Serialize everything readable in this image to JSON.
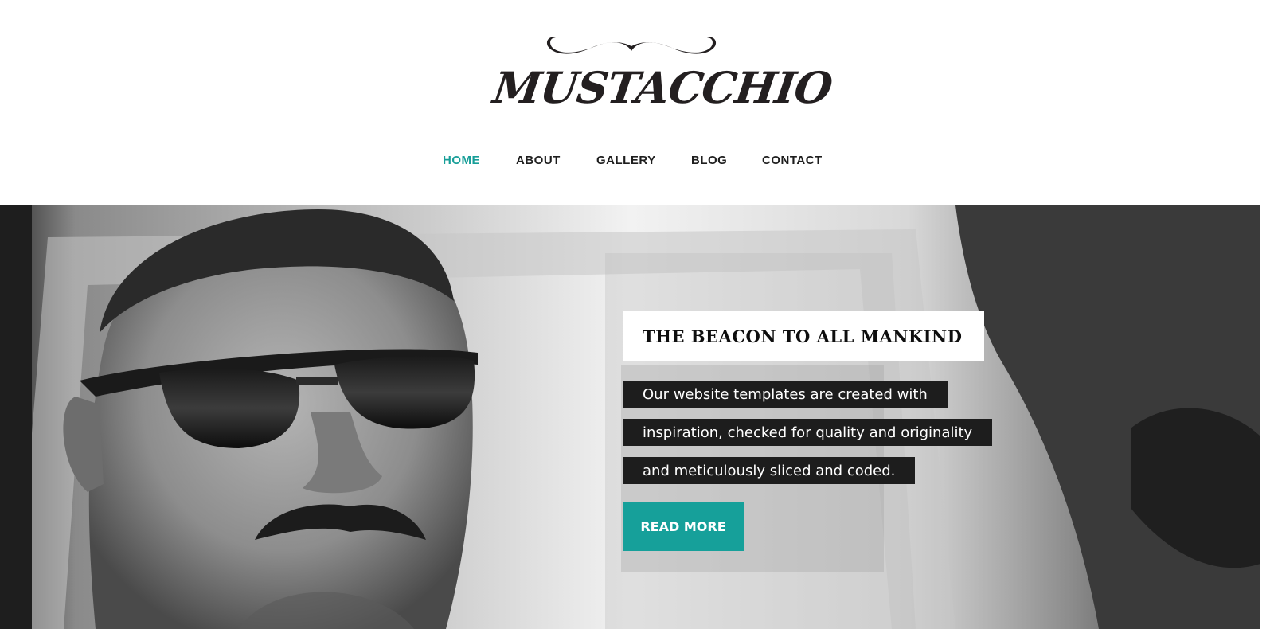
{
  "site": {
    "logo_text": "MUSTACCHIO"
  },
  "nav": {
    "items": [
      {
        "label": "HOME",
        "active": true
      },
      {
        "label": "ABOUT",
        "active": false
      },
      {
        "label": "GALLERY",
        "active": false
      },
      {
        "label": "BLOG",
        "active": false
      },
      {
        "label": "CONTACT",
        "active": false
      }
    ]
  },
  "hero": {
    "tagline": "THE BEACON TO ALL MANKIND",
    "description_lines": [
      "Our website templates are created with",
      "inspiration, checked for quality and originality",
      "and meticulously sliced and coded."
    ],
    "button_label": "READ MORE",
    "photo_icon": "man-with-sunglasses-photo-icon"
  },
  "colors": {
    "accent": "#16a09a",
    "nav_active": "#179e98",
    "text_dark": "#1e1e1e",
    "desc_bg": "#1d1d1d"
  }
}
